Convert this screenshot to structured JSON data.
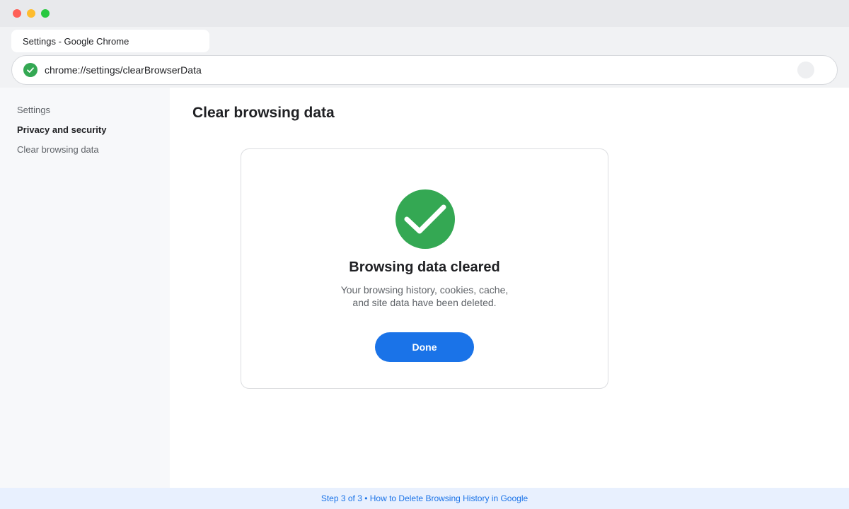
{
  "window": {
    "tab_title": "Settings - Google Chrome",
    "url": "chrome://settings/clearBrowserData",
    "icons": {
      "secure": "check-circle-icon",
      "omnibox_action": "profile-icon"
    }
  },
  "sidebar": {
    "items": [
      {
        "label": "Settings",
        "active": false
      },
      {
        "label": "Privacy and security",
        "active": true
      },
      {
        "label": "Clear browsing data",
        "active": false
      }
    ]
  },
  "main": {
    "title": "Clear browsing data",
    "dialog": {
      "icon": "success-check-icon",
      "heading": "Browsing data cleared",
      "message_line1": "Your browsing history, cookies, cache,",
      "message_line2": "and site data have been deleted.",
      "done_label": "Done"
    }
  },
  "footer": {
    "text": "Step 3 of 3 • How to Delete Browsing History in Google"
  },
  "colors": {
    "accent": "#1a73e8",
    "success": "#34a853",
    "text_primary": "#202124",
    "text_secondary": "#5f6368"
  }
}
